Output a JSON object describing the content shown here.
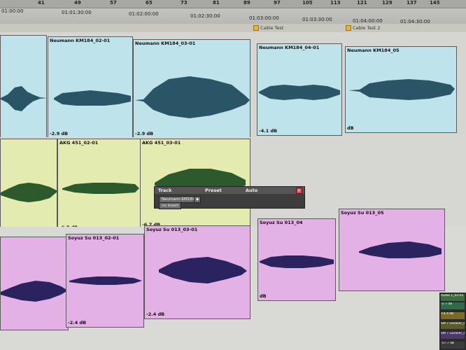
{
  "ruler": {
    "bars": [
      "41",
      "49",
      "57",
      "65",
      "73",
      "81",
      "89",
      "97",
      "105",
      "113",
      "121",
      "129",
      "137",
      "145"
    ],
    "timecodes": [
      "01:00:00",
      "01:01:30:00",
      "01:02:00:00",
      "01:02:30:00",
      "01:03:00:00",
      "01:03:30:00",
      "01:04:00:00",
      "01:04:30:00"
    ]
  },
  "markers": [
    "Cable Test",
    "Cable Test 2"
  ],
  "tracks": [
    {
      "name": "blue",
      "color": "#bfe3ea",
      "clips": [
        {
          "name": "",
          "gain": ""
        },
        {
          "name": "Neumann KM184_02-01",
          "gain": "-2.9 dB"
        },
        {
          "name": "Neumann KM184_03-01",
          "gain": "-2.9 dB"
        },
        {
          "name": "Neumann KM184_04-01",
          "gain": "-4.1 dB"
        },
        {
          "name": "Neumann KM184_05",
          "gain": "dB"
        }
      ]
    },
    {
      "name": "green",
      "color": "#e4ebb0",
      "clips": [
        {
          "name": "",
          "gain": ""
        },
        {
          "name": "AKG 451_02-01",
          "gain": "-6.7 dB"
        },
        {
          "name": "AKG 451_03-01",
          "gain": "-6.7 dB"
        }
      ]
    },
    {
      "name": "pink",
      "color": "#e4b1e6",
      "clips": [
        {
          "name": "",
          "gain": ""
        },
        {
          "name": "Soyuz Su 013_02-01",
          "gain": "-2.4 dB"
        },
        {
          "name": "Soyuz Su 013_03-01",
          "gain": "-2.4 dB"
        },
        {
          "name": "Soyuz Su 013_04",
          "gain": "dB"
        },
        {
          "name": "Soyuz Su 013_05",
          "gain": ""
        }
      ]
    }
  ],
  "popup": {
    "headers": [
      "Track",
      "Preset",
      "Auto"
    ],
    "track_button": "Neumann KM184",
    "insert_button": "no insert"
  },
  "mini_tracks": [
    "Audio 1_02-01",
    "-2.7 dB",
    "+4.4 dB",
    "SM 7 Lavalier_03-01",
    "SM 7 Lavalier_03-01",
    "-57.7 dB"
  ]
}
